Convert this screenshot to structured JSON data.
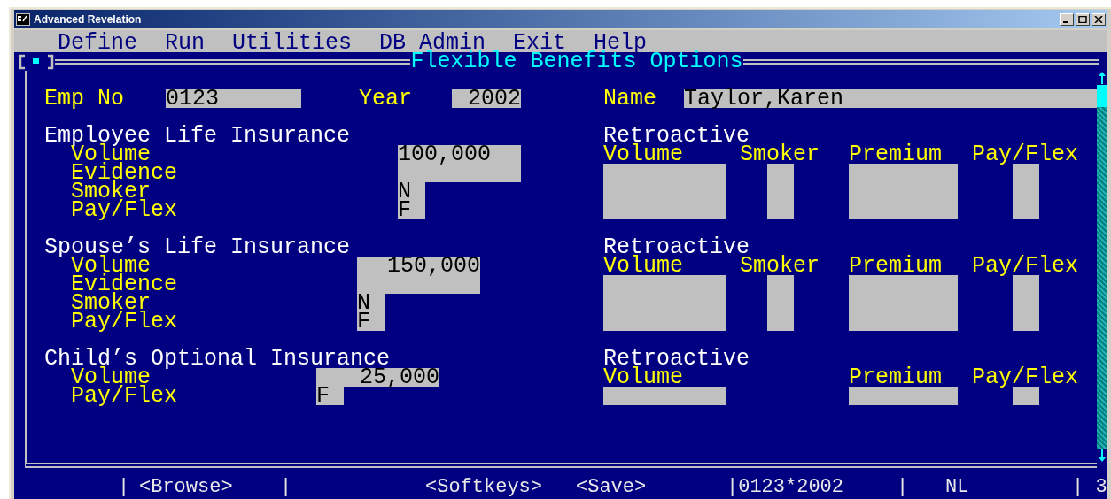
{
  "window": {
    "title": "Advanced Revelation"
  },
  "menu": [
    "Define",
    "Run",
    "Utilities",
    "DB Admin",
    "Exit",
    "Help"
  ],
  "form_title": "Flexible Benefits Options",
  "header_fields": [
    {
      "label": "Emp No",
      "value": "0123"
    },
    {
      "label": "Year",
      "value": "2002"
    },
    {
      "label": "Name",
      "value": "Taylor,Karen"
    }
  ],
  "sections": [
    {
      "title": "Employee Life Insurance",
      "fields": [
        {
          "label": "Volume",
          "kind": "amount",
          "value": "100,000"
        },
        {
          "label": "Evidence",
          "kind": "blank"
        },
        {
          "label": "Smoker",
          "kind": "flag",
          "value": "N"
        },
        {
          "label": "Pay/Flex",
          "kind": "flag",
          "value": "F"
        }
      ],
      "retro_title": "Retroactive",
      "retro_columns": [
        {
          "label": "Volume",
          "kind": "volume"
        },
        {
          "label": "Smoker",
          "kind": "smoker"
        },
        {
          "label": "Premium",
          "kind": "premium"
        },
        {
          "label": "Pay/Flex",
          "kind": "payflex"
        }
      ]
    },
    {
      "title": "Spouse’s Life Insurance",
      "fields": [
        {
          "label": "Volume",
          "kind": "amount",
          "value": "150,000"
        },
        {
          "label": "Evidence",
          "kind": "blank"
        },
        {
          "label": "Smoker",
          "kind": "flag",
          "value": "N"
        },
        {
          "label": "Pay/Flex",
          "kind": "flag",
          "value": "F"
        }
      ],
      "retro_title": "Retroactive",
      "retro_columns": [
        {
          "label": "Volume",
          "kind": "volume"
        },
        {
          "label": "Smoker",
          "kind": "smoker"
        },
        {
          "label": "Premium",
          "kind": "premium"
        },
        {
          "label": "Pay/Flex",
          "kind": "payflex"
        }
      ]
    },
    {
      "title": "Child’s Optional Insurance",
      "fields": [
        {
          "label": "Volume",
          "kind": "amount",
          "value": "25,000"
        },
        {
          "label": "Pay/Flex",
          "kind": "flag",
          "value": "F"
        }
      ],
      "retro_title": "Retroactive",
      "retro_columns": [
        {
          "label": "Volume",
          "kind": "volume"
        },
        {
          "label": "Premium",
          "kind": "premium"
        },
        {
          "label": "Pay/Flex",
          "kind": "payflex"
        }
      ]
    }
  ],
  "status_bar": [
    "|",
    "<Browse>",
    "|",
    "<Softkeys>",
    "<Save>",
    "|0123*2002",
    "|",
    "NL",
    "| 3"
  ]
}
